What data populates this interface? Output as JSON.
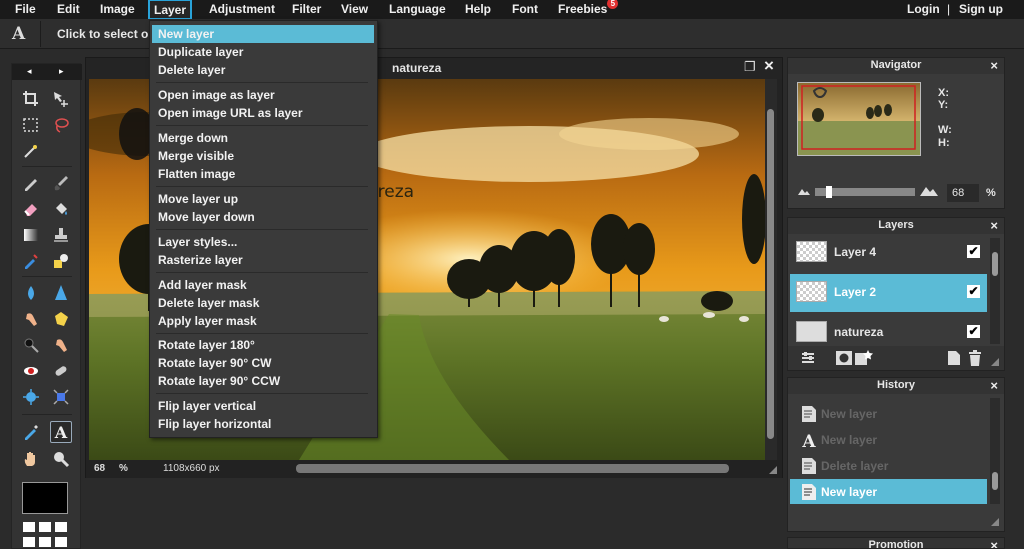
{
  "menu": {
    "items": [
      "File",
      "Edit",
      "Image",
      "Layer",
      "Adjustment",
      "Filter",
      "View",
      "Language",
      "Help",
      "Font",
      "Freebies"
    ],
    "active": "Layer",
    "freebies_badge": "5",
    "login": "Login",
    "separator": "|",
    "signup": "Sign up"
  },
  "options_bar": {
    "tool_glyph": "A",
    "hint": "Click to select or"
  },
  "toolbox": {
    "prev_arrow": "◂",
    "next_arrow": "▸",
    "tools": [
      "crop-tool",
      "move-tool",
      "marquee-tool",
      "lasso-tool",
      "wand-tool",
      "pencil-tool",
      "brush-tool",
      "eraser-tool",
      "bucket-tool",
      "gradient-tool",
      "stamp-tool",
      "color-replace-tool",
      "drawing-tool",
      "blur-tool",
      "sharpen-tool",
      "smudge-tool",
      "sponge-tool",
      "burn-tool",
      "dodge-tool",
      "redeye-tool",
      "spot-heal-tool",
      "bloat-tool",
      "pinch-tool",
      "picker-tool",
      "type-tool",
      "hand-tool",
      "zoom-tool"
    ],
    "colors": {
      "foreground": "#000000"
    }
  },
  "canvas": {
    "title": "natureza",
    "overlay_text": "natureza",
    "zoom": "68",
    "zoom_unit": "%",
    "dimensions": "1108x660 px",
    "restore_glyph": "❐",
    "close_glyph": "×"
  },
  "layer_menu": {
    "groups": [
      [
        "New layer",
        "Duplicate layer",
        "Delete layer"
      ],
      [
        "Open image as layer",
        "Open image URL as layer"
      ],
      [
        "Merge down",
        "Merge visible",
        "Flatten image"
      ],
      [
        "Move layer up",
        "Move layer down"
      ],
      [
        "Layer styles...",
        "Rasterize layer"
      ],
      [
        "Add layer mask",
        "Delete layer mask",
        "Apply layer mask"
      ],
      [
        "Rotate layer 180°",
        "Rotate layer 90° CW",
        "Rotate layer 90° CCW"
      ],
      [
        "Flip layer vertical",
        "Flip layer horizontal"
      ]
    ],
    "highlighted": "New layer"
  },
  "navigator": {
    "title": "Navigator",
    "close": "×",
    "x_label": "X:",
    "y_label": "Y:",
    "w_label": "W:",
    "h_label": "H:",
    "zoom_value": "68",
    "zoom_unit": "%",
    "zoom_fraction": 0.12
  },
  "layers": {
    "title": "Layers",
    "close": "×",
    "items": [
      {
        "name": "Layer 4",
        "visible": "✔",
        "selected": false
      },
      {
        "name": "Layer 2",
        "visible": "✔",
        "selected": true
      },
      {
        "name": "natureza",
        "visible": "✔",
        "selected": false
      }
    ]
  },
  "history": {
    "title": "History",
    "close": "×",
    "items": [
      {
        "label": "New layer",
        "icon": "doc-icon",
        "selected": false
      },
      {
        "label": "New layer",
        "icon": "type-icon",
        "selected": false
      },
      {
        "label": "Delete layer",
        "icon": "doc-icon",
        "selected": false
      },
      {
        "label": "New layer",
        "icon": "doc-icon",
        "selected": true
      }
    ]
  },
  "promotion": {
    "title": "Promotion",
    "close": "×"
  },
  "colors": {
    "accent": "#5bbbd6",
    "menu_active_border": "#29a3d9",
    "badge": "#e03030"
  }
}
